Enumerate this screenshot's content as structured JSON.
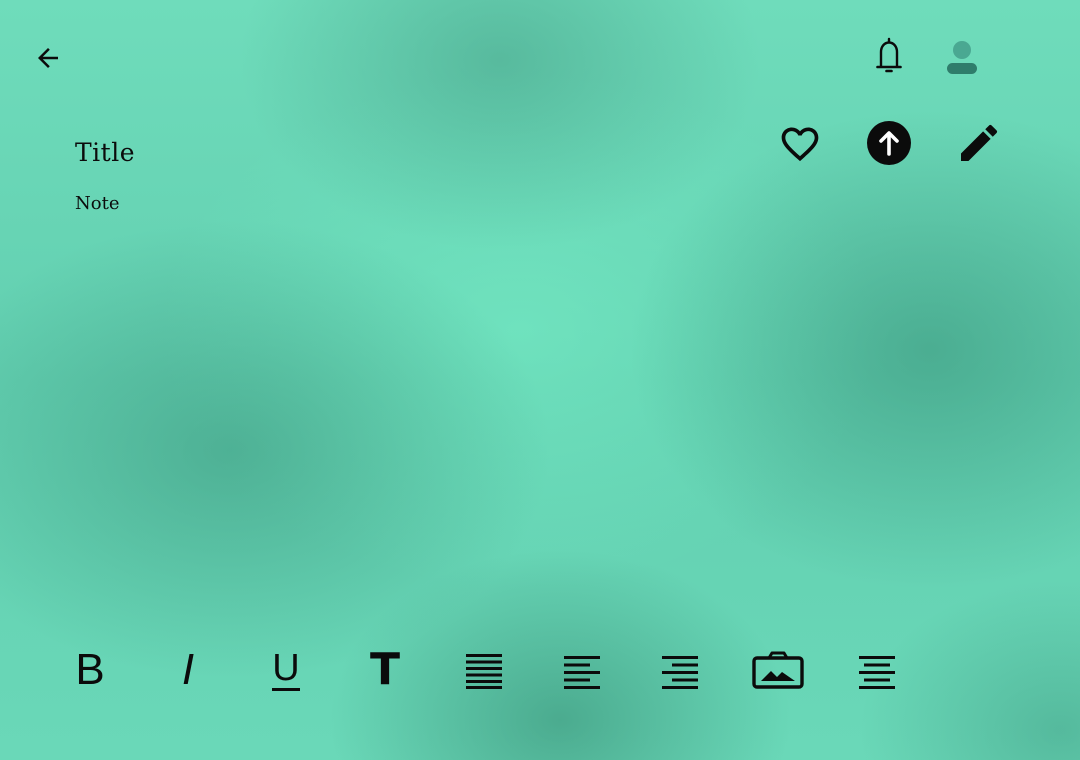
{
  "header": {
    "back_icon": "arrow-left-icon",
    "notifications_icon": "bell-icon",
    "avatar_icon": "person-icon"
  },
  "actions": {
    "favorite_icon": "heart-outline-icon",
    "upload_icon": "arrow-up-circle-icon",
    "edit_icon": "pencil-icon"
  },
  "note": {
    "title": "Title",
    "body": "Note"
  },
  "toolbar": {
    "bold_label": "B",
    "italic_label": "I",
    "underline_label": "U",
    "heading_label": "T",
    "items": [
      "bold",
      "italic",
      "underline",
      "text-size",
      "justify",
      "align-left",
      "align-right",
      "insert-image",
      "align-center"
    ]
  },
  "colors": {
    "background": "#66d6b5",
    "icon": "#0b0b0b",
    "avatar": "#3f9c86"
  }
}
